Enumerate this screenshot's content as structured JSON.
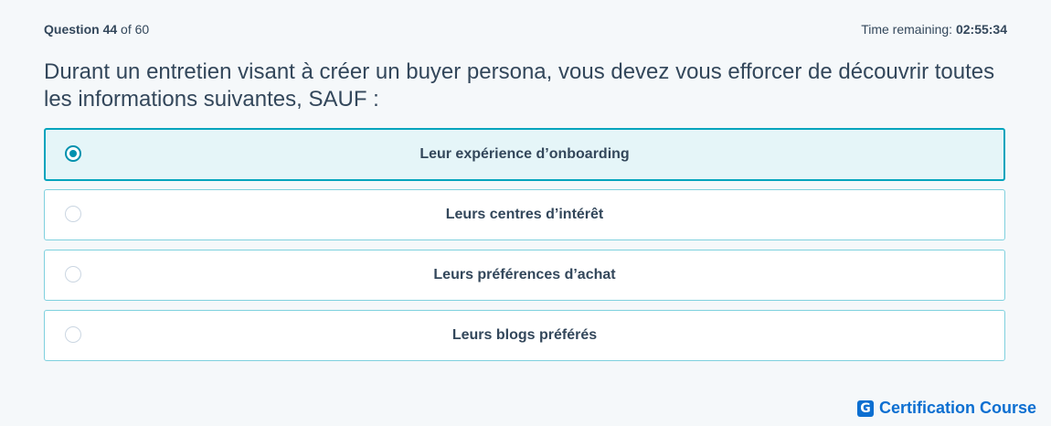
{
  "header": {
    "question_label": "Question",
    "question_number": "44",
    "question_of": "of 60",
    "time_label": "Time remaining:",
    "time_value": "02:55:34"
  },
  "question": {
    "text": "Durant un entretien visant à créer un buyer persona, vous devez vous efforcer de découvrir toutes les informations suivantes, SAUF :"
  },
  "options": [
    {
      "label": "Leur expérience d’onboarding",
      "selected": true
    },
    {
      "label": "Leurs centres d’intérêt",
      "selected": false
    },
    {
      "label": "Leurs préférences d’achat",
      "selected": false
    },
    {
      "label": "Leurs blogs préférés",
      "selected": false
    }
  ],
  "brand": {
    "icon_letter": "G",
    "name": "Certification Course",
    "color": "#0c6fd1"
  },
  "colors": {
    "accent": "#00a4bd",
    "selected_bg": "#e5f5f8",
    "text": "#33475b"
  }
}
